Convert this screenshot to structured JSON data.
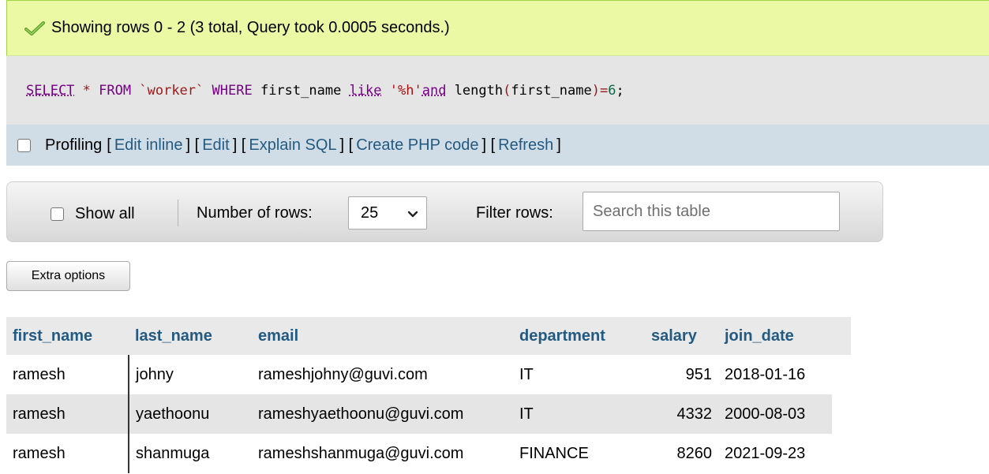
{
  "banner": {
    "message": "Showing rows 0 - 2 (3 total, Query took 0.0005 seconds.)"
  },
  "sql": {
    "select": "SELECT",
    "star": "*",
    "from": "FROM",
    "table": "`worker`",
    "where": "WHERE",
    "col1": "first_name",
    "like": "like",
    "pattern": "'%h'",
    "and": "and",
    "fn": "length",
    "paren_open": "(",
    "col2": "first_name",
    "paren_close": ")",
    "eq": "=",
    "num": "6",
    "semi": ";"
  },
  "profiling": {
    "label": "Profiling",
    "links": [
      "Edit inline",
      "Edit",
      "Explain SQL",
      "Create PHP code",
      "Refresh"
    ]
  },
  "nav": {
    "show_all": "Show all",
    "rows_label": "Number of rows:",
    "rows_value": "25",
    "filter_label": "Filter rows:",
    "search_placeholder": "Search this table"
  },
  "extra_options": "Extra options",
  "table": {
    "columns": [
      "first_name",
      "last_name",
      "email",
      "department",
      "salary",
      "join_date"
    ],
    "rows": [
      [
        "ramesh",
        "johny",
        "rameshjohny@guvi.com",
        "IT",
        "951",
        "2018-01-16"
      ],
      [
        "ramesh",
        "yaethoonu",
        "rameshyaethoonu@guvi.com",
        "IT",
        "4332",
        "2000-08-03"
      ],
      [
        "ramesh",
        "shanmuga",
        "rameshshanmuga@guvi.com",
        "FINANCE",
        "8260",
        "2021-09-23"
      ]
    ]
  },
  "colors": {
    "link": "#235a81",
    "success_bg": "#ebf8a4",
    "profiling_bg": "#d1dde6"
  },
  "icons": {
    "success": "check-icon",
    "select": "chevron-down-icon"
  }
}
